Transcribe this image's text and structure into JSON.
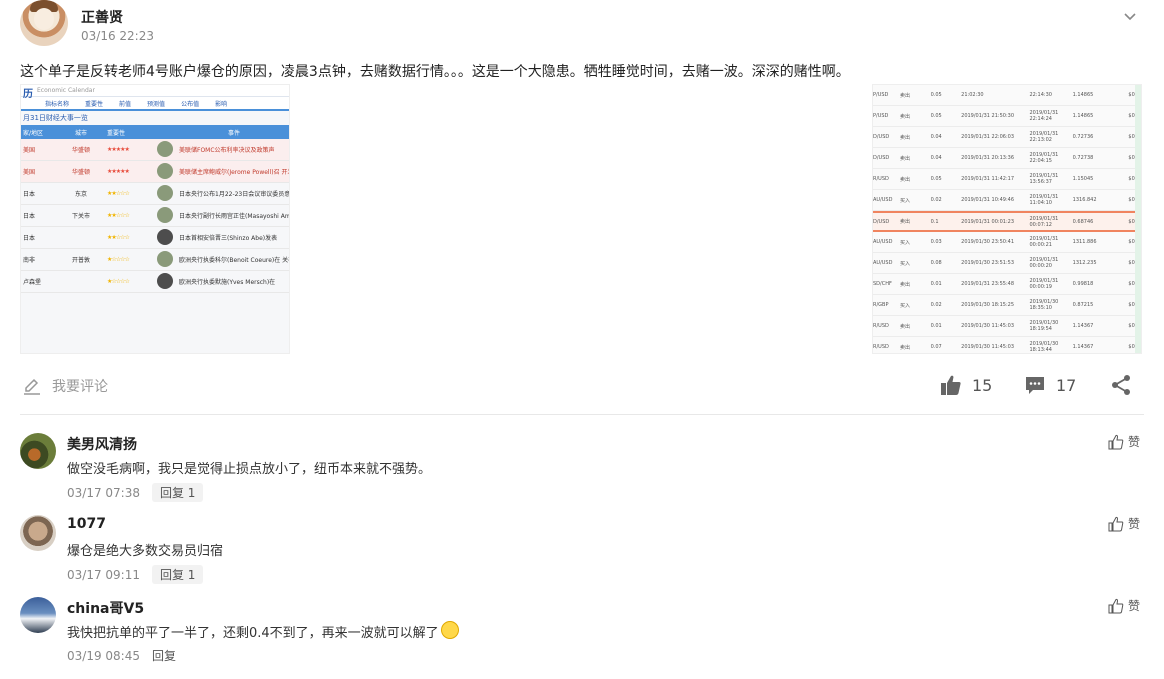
{
  "post": {
    "author": "正善贤",
    "time": "03/16 22:23",
    "text": "这个单子是反转老师4号账户爆仓的原因，凌晨3点钟，去赌数据行情。。。这是一个大隐患。牺牲睡觉时间，去赌一波。深深的赌性啊。"
  },
  "image_left": {
    "logo": "历",
    "title": "Economic Calendar",
    "nav": [
      "指标名称",
      "重要性",
      "前值",
      "预测值",
      "公布值",
      "影响"
    ],
    "subtitle": "月31日财经大事一览",
    "columns": [
      "家/地区",
      "城市",
      "重要性",
      "事件"
    ],
    "rows": [
      {
        "region": "美国",
        "city": "华盛顿",
        "stars": "★★★★★",
        "event": "美联储FOMC公布利率决议及政策声",
        "highlight": true
      },
      {
        "region": "美国",
        "city": "华盛顿",
        "stars": "★★★★★",
        "event": "美联储主席鲍威尔(Jerome Powell)召 开发布会。[回放]",
        "highlight": true
      },
      {
        "region": "日本",
        "city": "东京",
        "stars": "★★☆☆☆",
        "event": "日本央行公布1月22-23日会议审议委员意见摘",
        "highlight": false
      },
      {
        "region": "日本",
        "city": "下关市",
        "stars": "★★☆☆☆",
        "event": "日本央行副行长雨宫正佳(Masayoshi Amamiya) 经融发表演说，并举行记者会。",
        "highlight": false
      },
      {
        "region": "日本",
        "city": "",
        "stars": "★★☆☆☆",
        "event": "日本首相安倍晋三(Shinzo Abe)发表",
        "highlight": false
      },
      {
        "region": "南非",
        "city": "开普敦",
        "stars": "★☆☆☆☆",
        "event": "欧洲央行执委科尔(Benoit Coeure)在 关非洲金融产业监管的会议上发表主 话。",
        "highlight": false
      },
      {
        "region": "卢森堡",
        "city": "",
        "stars": "★☆☆☆☆",
        "event": "欧洲央行执委默施(Yves Mersch)在",
        "highlight": false
      }
    ]
  },
  "image_right": {
    "rows": [
      {
        "pair": "P/USD",
        "side": "卖出",
        "lots": "0.05",
        "open": "21:02:30",
        "close": "22:14:30",
        "price": "1.14865",
        "profit": "$0",
        "hl": false
      },
      {
        "pair": "P/USD",
        "side": "卖出",
        "lots": "0.05",
        "open": "2019/01/31 21:50:30",
        "close": "2019/01/31 22:14:24",
        "price": "1.14865",
        "profit": "$0",
        "hl": false
      },
      {
        "pair": "D/USD",
        "side": "卖出",
        "lots": "0.04",
        "open": "2019/01/31 22:06:03",
        "close": "2019/01/31 22:13:02",
        "price": "0.72736",
        "profit": "$0",
        "hl": false
      },
      {
        "pair": "D/USD",
        "side": "卖出",
        "lots": "0.04",
        "open": "2019/01/31 20:13:36",
        "close": "2019/01/31 22:04:15",
        "price": "0.72738",
        "profit": "$0",
        "hl": false
      },
      {
        "pair": "R/USD",
        "side": "卖出",
        "lots": "0.05",
        "open": "2019/01/31 11:42:17",
        "close": "2019/01/31 13:56:37",
        "price": "1.15045",
        "profit": "$0",
        "hl": false
      },
      {
        "pair": "AU/USD",
        "side": "买入",
        "lots": "0.02",
        "open": "2019/01/31 10:49:46",
        "close": "2019/01/31 11:04:10",
        "price": "1316.842",
        "profit": "$0",
        "hl": false
      },
      {
        "pair": "D/USD",
        "side": "卖出",
        "lots": "0.1",
        "open": "2019/01/31 00:01:23",
        "close": "2019/01/31 00:07:12",
        "price": "0.68746",
        "profit": "$0",
        "hl": true
      },
      {
        "pair": "AU/USD",
        "side": "买入",
        "lots": "0.03",
        "open": "2019/01/30 23:50:41",
        "close": "2019/01/31 00:00:21",
        "price": "1311.886",
        "profit": "$0",
        "hl": false
      },
      {
        "pair": "AU/USD",
        "side": "买入",
        "lots": "0.08",
        "open": "2019/01/30 23:51:53",
        "close": "2019/01/31 00:00:20",
        "price": "1312.235",
        "profit": "$0",
        "hl": false
      },
      {
        "pair": "SD/CHF",
        "side": "卖出",
        "lots": "0.01",
        "open": "2019/01/31 23:55:48",
        "close": "2019/01/31 00:00:19",
        "price": "0.99818",
        "profit": "$0",
        "hl": false
      },
      {
        "pair": "R/GBP",
        "side": "买入",
        "lots": "0.02",
        "open": "2019/01/30 18:15:25",
        "close": "2019/01/30 18:35:10",
        "price": "0.87215",
        "profit": "$0",
        "hl": false
      },
      {
        "pair": "R/USD",
        "side": "卖出",
        "lots": "0.01",
        "open": "2019/01/30 11:45:03",
        "close": "2019/01/30 18:19:54",
        "price": "1.14367",
        "profit": "$0",
        "hl": false
      },
      {
        "pair": "R/USD",
        "side": "卖出",
        "lots": "0.07",
        "open": "2019/01/30 11:45:03",
        "close": "2019/01/30 18:13:44",
        "price": "1.14367",
        "profit": "$0",
        "hl": false
      }
    ]
  },
  "actions": {
    "comment_placeholder": "我要评论",
    "likes": "15",
    "comments": "17"
  },
  "comments": [
    {
      "name": "美男风清扬",
      "text": "做空没毛病啊，我只是觉得止损点放小了，纽币本来就不强势。",
      "time": "03/17 07:38",
      "reply": "回复 1",
      "like": "赞"
    },
    {
      "name": "1077",
      "text": "爆仓是绝大多数交易员归宿",
      "time": "03/17 09:11",
      "reply": "回复 1",
      "like": "赞"
    },
    {
      "name": "china哥V5",
      "text": "我快把抗单的平了一半了，还剩0.4不到了，再来一波就可以解了",
      "time": "03/19 08:45",
      "reply": "回复",
      "like": "赞"
    }
  ],
  "colors": {
    "accent": "#4a90d9",
    "highlight": "#f0845f",
    "text_muted": "#888888"
  }
}
